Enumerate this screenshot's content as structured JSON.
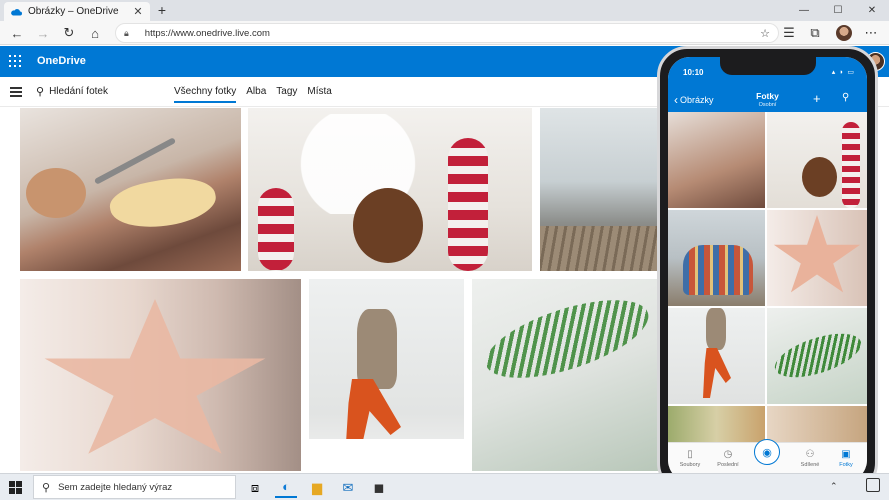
{
  "browser": {
    "tab_title": "Obrázky – OneDrive",
    "new_tab": "+",
    "url": "https://www.onedrive.live.com",
    "window_controls": [
      "—",
      "☐",
      "✕"
    ]
  },
  "onedrive": {
    "brand": "OneDrive",
    "search_label": "Hledání fotek",
    "tabs": [
      {
        "label": "Všechny fotky",
        "active": true
      },
      {
        "label": "Alba",
        "active": false
      },
      {
        "label": "Tagy",
        "active": false
      },
      {
        "label": "Místa",
        "active": false
      }
    ]
  },
  "phone": {
    "time": "10:10",
    "status": "▴ ◗ ▭",
    "back_label": "Obrázky",
    "title": "Fotky",
    "subtitle": "Osobní",
    "bottom_nav": [
      {
        "label": "Soubory",
        "icon": "file-icon",
        "active": false
      },
      {
        "label": "Poslední",
        "icon": "clock-icon",
        "active": false
      },
      {
        "label": "Sdílené",
        "icon": "people-icon",
        "active": false
      },
      {
        "label": "Fotky",
        "icon": "photo-icon",
        "active": true
      }
    ]
  },
  "taskbar": {
    "search_placeholder": "Sem zadejte hledaný výraz"
  },
  "colors": {
    "brand": "#0078d4",
    "taskbar": "#e8ecf1"
  }
}
